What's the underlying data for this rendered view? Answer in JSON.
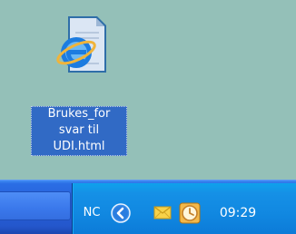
{
  "desktop": {
    "file": {
      "label_lines": [
        "Brukes_for",
        "svar til",
        "UDI.html"
      ],
      "icon": "internet-explorer-html-file-icon"
    }
  },
  "taskbar": {
    "tray": {
      "language": "NC",
      "expand_icon": "chevron-left-icon",
      "mail_icon": "envelope-icon",
      "clock_icon": "clock-icon",
      "time": "09:29"
    }
  },
  "colors": {
    "desktop_background": "#94c0b8",
    "selection": "#316ac5",
    "taskbar": "#2860d8",
    "tray": "#1188e1"
  }
}
